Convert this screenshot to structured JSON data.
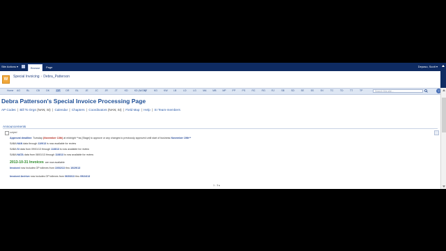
{
  "ribbon": {
    "site_actions": "Site Actions ▾",
    "tabs": [
      "Browse",
      "Page"
    ],
    "user": "Depaso, Scott ▾",
    "help": "?"
  },
  "breadcrumb": {
    "parent": "Special Invoicing",
    "separator": "›",
    "current": "Debra_Patterson"
  },
  "logo_letter": "W",
  "top_nav": {
    "items": [
      "Home",
      "AG",
      "BL",
      "CB",
      "DK",
      "DP",
      "DR",
      "BL",
      "JE",
      "JC",
      "JR",
      "JT",
      "KD",
      "KD (NATA)",
      "KF",
      "KG",
      "KW",
      "LB",
      "LD",
      "LG",
      "MA",
      "MB",
      "MP",
      "PP",
      "PS",
      "RC",
      "RG",
      "RJ",
      "SB",
      "SD",
      "SE",
      "SS",
      "SV",
      "TC",
      "TD",
      "TT",
      "TP"
    ],
    "selected_index": 5,
    "search_placeholder": "Search this site..."
  },
  "page_title": "Debra Patterson's Special Invoice Processing Page",
  "quick_links": [
    {
      "label": "AP Codes"
    },
    {
      "label": "Bill To Orgs",
      "suffix": "(NAN; SI)"
    },
    {
      "label": "Calendar"
    },
    {
      "label": "Chapters"
    },
    {
      "label": "Coordinators",
      "suffix": "(NAN; SI)"
    },
    {
      "label": "Field Map"
    },
    {
      "label": "Help"
    },
    {
      "label": "SI Team-members"
    }
  ],
  "announcements": {
    "header": "Announcements",
    "author": "outyed",
    "lines": [
      {
        "parts": [
          {
            "t": "Approval deadline:",
            "s": "blue"
          },
          {
            "t": " Tuesday "
          },
          {
            "t": "(November 13th)",
            "s": "red"
          },
          {
            "t": " at midnight **as [Stage] to approve or any changes to previously approved until start of business "
          },
          {
            "t": "November 19th**",
            "s": "blue"
          }
        ]
      },
      {
        "parts": [
          {
            "t": "SABA "
          },
          {
            "t": "NAN",
            "s": "blue"
          },
          {
            "t": " data through "
          },
          {
            "t": "11/9/13",
            "s": "blue"
          },
          {
            "t": " is now available for review"
          }
        ]
      },
      {
        "parts": [
          {
            "t": "SABA "
          },
          {
            "t": "SI",
            "s": "blue"
          },
          {
            "t": " data from 09/01/13 through "
          },
          {
            "t": "11/8/13",
            "s": "blue"
          },
          {
            "t": " is now available for review"
          }
        ]
      },
      {
        "parts": [
          {
            "t": "SABA "
          },
          {
            "t": "NATA",
            "s": "blue"
          },
          {
            "t": " data from 08/01/13 through "
          },
          {
            "t": "11/8/13",
            "s": "blue"
          },
          {
            "t": " is now available for review"
          }
        ]
      }
    ],
    "invoices_heading": "2013-10-31 Invoices",
    "invoices_suffix": "are now available",
    "invoiced_line": {
      "parts": [
        {
          "t": "Invoiced",
          "s": "blue"
        },
        {
          "t": " now includes GP tollexes from "
        },
        {
          "t": "10/02/13",
          "s": "blue"
        },
        {
          "t": " thru "
        },
        {
          "t": "10/29/13",
          "s": "blue"
        }
      ]
    },
    "archive_line": {
      "parts": [
        {
          "t": "Invoiced Archive",
          "s": "blue"
        },
        {
          "t": " now includes GP tollexes from "
        },
        {
          "t": "06/03/13",
          "s": "blue"
        },
        {
          "t": " thru "
        },
        {
          "t": "09/24/13",
          "s": "blue"
        }
      ]
    },
    "pager": "1 - 3 ▸"
  }
}
